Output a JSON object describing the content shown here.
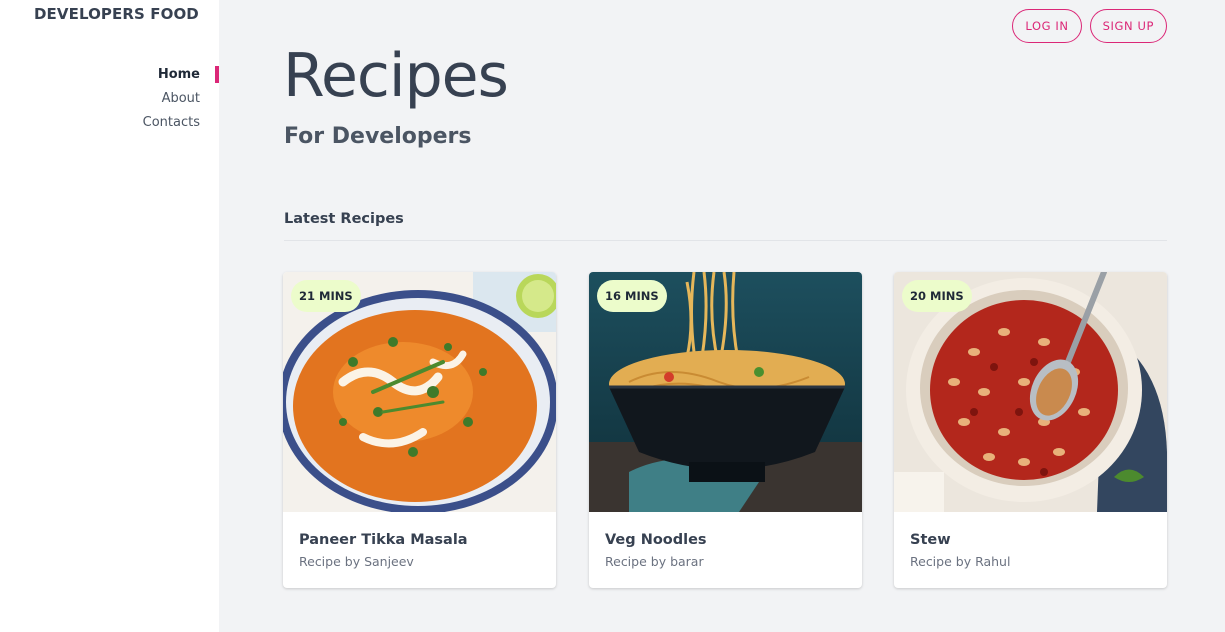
{
  "brand": "DEVELOPERS FOOD",
  "nav": {
    "items": [
      {
        "label": "Home",
        "active": true
      },
      {
        "label": "About",
        "active": false
      },
      {
        "label": "Contacts",
        "active": false
      }
    ]
  },
  "auth": {
    "login_label": "LOG IN",
    "signup_label": "SIGN UP"
  },
  "header": {
    "title": "Recipes",
    "subtitle": "For Developers"
  },
  "section": {
    "heading": "Latest Recipes"
  },
  "recipes": [
    {
      "time": "21 MINS",
      "title": "Paneer Tikka Masala",
      "author": "Recipe by Sanjeev",
      "image": "curry-bowl"
    },
    {
      "time": "16 MINS",
      "title": "Veg Noodles",
      "author": "Recipe by barar",
      "image": "noodle-bowl"
    },
    {
      "time": "20 MINS",
      "title": "Stew",
      "author": "Recipe by Rahul",
      "image": "bean-stew-pot"
    }
  ],
  "colors": {
    "accent": "#db2777",
    "badge": "#ecfccb",
    "background": "#f2f3f5"
  }
}
